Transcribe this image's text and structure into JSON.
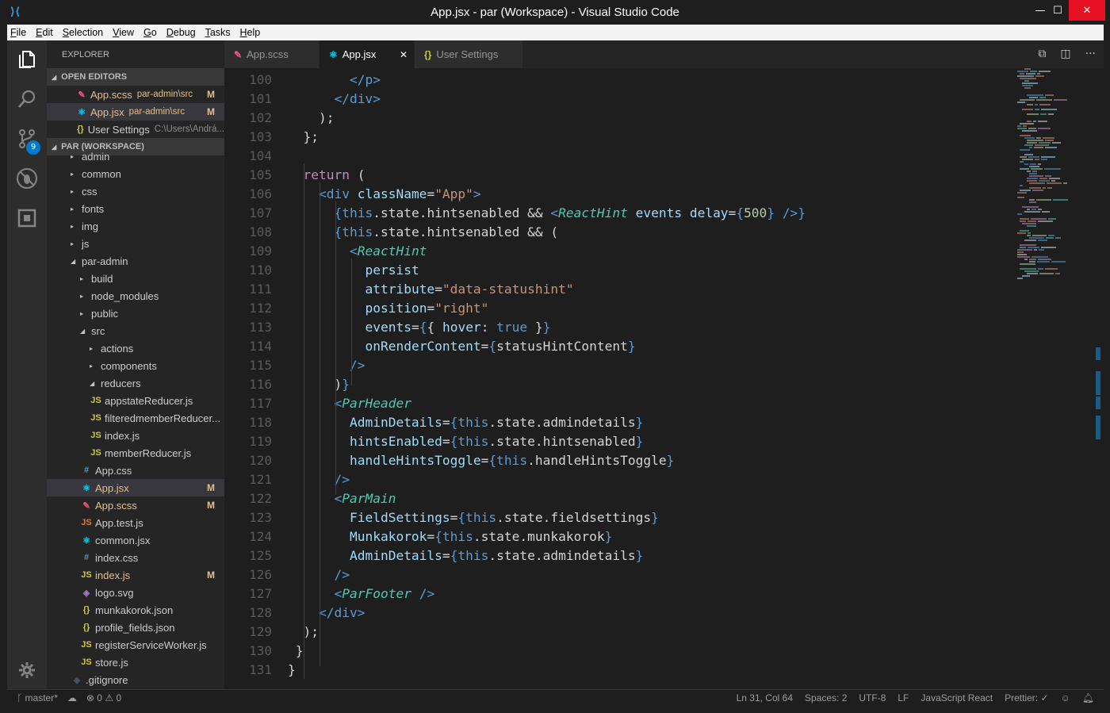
{
  "window": {
    "title": "App.jsx - par (Workspace) - Visual Studio Code",
    "min": "—",
    "max": "☐",
    "close": "✕"
  },
  "menu": [
    {
      "label": "File",
      "u": "F",
      "rest": "ile"
    },
    {
      "label": "Edit",
      "u": "E",
      "rest": "dit"
    },
    {
      "label": "Selection",
      "u": "S",
      "rest": "election"
    },
    {
      "label": "View",
      "u": "V",
      "rest": "iew"
    },
    {
      "label": "Go",
      "u": "G",
      "rest": "o"
    },
    {
      "label": "Debug",
      "u": "D",
      "rest": "ebug"
    },
    {
      "label": "Tasks",
      "u": "T",
      "rest": "asks"
    },
    {
      "label": "Help",
      "u": "H",
      "rest": "elp"
    }
  ],
  "activity": {
    "scm_badge": "9"
  },
  "sidebar": {
    "title": "EXPLORER",
    "open_editors_label": "OPEN EDITORS",
    "workspace_label": "PAR (WORKSPACE)",
    "open_editors": [
      {
        "name": "App.scss",
        "desc": "par-admin\\src",
        "mod": "M",
        "icon": "✎",
        "color": "#e2c08d",
        "iconColor": "#f55385"
      },
      {
        "name": "App.jsx",
        "desc": "par-admin\\src",
        "mod": "M",
        "icon": "⚛",
        "color": "#e2c08d",
        "iconColor": "#00d8ff"
      },
      {
        "name": "User Settings",
        "desc": "C:\\Users\\Andrá...",
        "mod": "",
        "icon": "{}",
        "color": "#cccccc",
        "iconColor": "#cbcb41"
      }
    ],
    "tree": [
      {
        "name": "admin",
        "indent": 0,
        "arrow": "▸",
        "icon": "",
        "mod": ""
      },
      {
        "name": "common",
        "indent": 0,
        "arrow": "▸",
        "icon": "",
        "mod": ""
      },
      {
        "name": "css",
        "indent": 0,
        "arrow": "▸",
        "icon": "",
        "mod": ""
      },
      {
        "name": "fonts",
        "indent": 0,
        "arrow": "▸",
        "icon": "",
        "mod": ""
      },
      {
        "name": "img",
        "indent": 0,
        "arrow": "▸",
        "icon": "",
        "mod": ""
      },
      {
        "name": "js",
        "indent": 0,
        "arrow": "▸",
        "icon": "",
        "mod": ""
      },
      {
        "name": "par-admin",
        "indent": 0,
        "arrow": "◢",
        "icon": "",
        "mod": ""
      },
      {
        "name": "build",
        "indent": 1,
        "arrow": "▸",
        "icon": "",
        "mod": ""
      },
      {
        "name": "node_modules",
        "indent": 1,
        "arrow": "▸",
        "icon": "",
        "mod": ""
      },
      {
        "name": "public",
        "indent": 1,
        "arrow": "▸",
        "icon": "",
        "mod": ""
      },
      {
        "name": "src",
        "indent": 1,
        "arrow": "◢",
        "icon": "",
        "mod": ""
      },
      {
        "name": "actions",
        "indent": 2,
        "arrow": "▸",
        "icon": "",
        "mod": ""
      },
      {
        "name": "components",
        "indent": 2,
        "arrow": "▸",
        "icon": "",
        "mod": ""
      },
      {
        "name": "reducers",
        "indent": 2,
        "arrow": "◢",
        "icon": "",
        "mod": ""
      },
      {
        "name": "appstateReducer.js",
        "indent": 3,
        "arrow": "",
        "icon": "JS",
        "iconColor": "#cbcb41",
        "mod": ""
      },
      {
        "name": "filteredmemberReducer...",
        "indent": 3,
        "arrow": "",
        "icon": "JS",
        "iconColor": "#cbcb41",
        "mod": ""
      },
      {
        "name": "index.js",
        "indent": 3,
        "arrow": "",
        "icon": "JS",
        "iconColor": "#cbcb41",
        "mod": ""
      },
      {
        "name": "memberReducer.js",
        "indent": 3,
        "arrow": "",
        "icon": "JS",
        "iconColor": "#cbcb41",
        "mod": ""
      },
      {
        "name": "App.css",
        "indent": 2,
        "arrow": "",
        "icon": "#",
        "iconColor": "#519aba",
        "mod": ""
      },
      {
        "name": "App.jsx",
        "indent": 2,
        "arrow": "",
        "icon": "⚛",
        "iconColor": "#00d8ff",
        "mod": "M",
        "selected": true
      },
      {
        "name": "App.scss",
        "indent": 2,
        "arrow": "",
        "icon": "✎",
        "iconColor": "#f55385",
        "mod": "M"
      },
      {
        "name": "App.test.js",
        "indent": 2,
        "arrow": "",
        "icon": "JS",
        "iconColor": "#e37933",
        "mod": ""
      },
      {
        "name": "common.jsx",
        "indent": 2,
        "arrow": "",
        "icon": "⚛",
        "iconColor": "#00d8ff",
        "mod": ""
      },
      {
        "name": "index.css",
        "indent": 2,
        "arrow": "",
        "icon": "#",
        "iconColor": "#519aba",
        "mod": ""
      },
      {
        "name": "index.js",
        "indent": 2,
        "arrow": "",
        "icon": "JS",
        "iconColor": "#cbcb41",
        "mod": "M"
      },
      {
        "name": "logo.svg",
        "indent": 2,
        "arrow": "",
        "icon": "◈",
        "iconColor": "#a074c4",
        "mod": ""
      },
      {
        "name": "munkakorok.json",
        "indent": 2,
        "arrow": "",
        "icon": "{}",
        "iconColor": "#cbcb41",
        "mod": ""
      },
      {
        "name": "profile_fields.json",
        "indent": 2,
        "arrow": "",
        "icon": "{}",
        "iconColor": "#cbcb41",
        "mod": ""
      },
      {
        "name": "registerServiceWorker.js",
        "indent": 2,
        "arrow": "",
        "icon": "JS",
        "iconColor": "#cbcb41",
        "mod": ""
      },
      {
        "name": "store.js",
        "indent": 2,
        "arrow": "",
        "icon": "JS",
        "iconColor": "#cbcb41",
        "mod": ""
      },
      {
        "name": ".gitignore",
        "indent": 1,
        "arrow": "",
        "icon": "◆",
        "iconColor": "#41535b",
        "mod": ""
      }
    ]
  },
  "tabs": [
    {
      "label": "App.scss",
      "icon": "✎",
      "iconColor": "#f55385",
      "active": false
    },
    {
      "label": "App.jsx",
      "icon": "⚛",
      "iconColor": "#00d8ff",
      "active": true,
      "close": "✕"
    },
    {
      "label": "User Settings",
      "icon": "{}",
      "iconColor": "#cbcb41",
      "active": false
    }
  ],
  "editor": {
    "lines": [
      {
        "n": "100",
        "html": "        <span class='tg'>&lt;/p&gt;</span>"
      },
      {
        "n": "101",
        "html": "      <span class='tg'>&lt;/div&gt;</span>"
      },
      {
        "n": "102",
        "html": "    );"
      },
      {
        "n": "103",
        "html": "  };"
      },
      {
        "n": "104",
        "html": ""
      },
      {
        "n": "105",
        "html": "  <span class='kw'>return</span> ("
      },
      {
        "n": "106",
        "html": "    <span class='tg'>&lt;div</span> <span class='at'>className</span>=<span class='st'>\"App\"</span><span class='tg'>&gt;</span>"
      },
      {
        "n": "107",
        "html": "      <span class='tg'>{</span><span class='th'>this</span>.state.hintsenabled &amp;&amp; <span class='tg'>&lt;</span><span class='cm'>ReactHint</span> <span class='at'>events</span> <span class='at'>delay</span>=<span class='tg'>{</span><span class='nm'>500</span><span class='tg'>}</span> <span class='tg'>/&gt;</span><span class='tg'>}</span>"
      },
      {
        "n": "108",
        "html": "      <span class='tg'>{</span><span class='th'>this</span>.state.hintsenabled &amp;&amp; ("
      },
      {
        "n": "109",
        "html": "        <span class='tg'>&lt;</span><span class='cm'>ReactHint</span>"
      },
      {
        "n": "110",
        "html": "          <span class='at'>persist</span>"
      },
      {
        "n": "111",
        "html": "          <span class='at'>attribute</span>=<span class='st'>\"data-statushint\"</span>"
      },
      {
        "n": "112",
        "html": "          <span class='at'>position</span>=<span class='st'>\"right\"</span>"
      },
      {
        "n": "113",
        "html": "          <span class='at'>events</span>=<span class='tg'>{</span>{ <span class='at'>hover</span>: <span class='th'>true</span> }<span class='tg'>}</span>"
      },
      {
        "n": "114",
        "html": "          <span class='at'>onRenderContent</span>=<span class='tg'>{</span>statusHintContent<span class='tg'>}</span>"
      },
      {
        "n": "115",
        "html": "        <span class='tg'>/&gt;</span>"
      },
      {
        "n": "116",
        "html": "      )<span class='tg'>}</span>"
      },
      {
        "n": "117",
        "html": "      <span class='tg'>&lt;</span><span class='cm'>ParHeader</span>"
      },
      {
        "n": "118",
        "html": "        <span class='at'>AdminDetails</span>=<span class='tg'>{</span><span class='th'>this</span>.state.admindetails<span class='tg'>}</span>"
      },
      {
        "n": "119",
        "html": "        <span class='at'>hintsEnabled</span>=<span class='tg'>{</span><span class='th'>this</span>.state.hintsenabled<span class='tg'>}</span>"
      },
      {
        "n": "120",
        "html": "        <span class='at'>handleHintsToggle</span>=<span class='tg'>{</span><span class='th'>this</span>.handleHintsToggle<span class='tg'>}</span>"
      },
      {
        "n": "121",
        "html": "      <span class='tg'>/&gt;</span>"
      },
      {
        "n": "122",
        "html": "      <span class='tg'>&lt;</span><span class='cm'>ParMain</span>"
      },
      {
        "n": "123",
        "html": "        <span class='at'>FieldSettings</span>=<span class='tg'>{</span><span class='th'>this</span>.state.fieldsettings<span class='tg'>}</span>"
      },
      {
        "n": "124",
        "html": "        <span class='at'>Munkakorok</span>=<span class='tg'>{</span><span class='th'>this</span>.state.munkakorok<span class='tg'>}</span>"
      },
      {
        "n": "125",
        "html": "        <span class='at'>AdminDetails</span>=<span class='tg'>{</span><span class='th'>this</span>.state.admindetails<span class='tg'>}</span>"
      },
      {
        "n": "126",
        "html": "      <span class='tg'>/&gt;</span>"
      },
      {
        "n": "127",
        "html": "      <span class='tg'>&lt;</span><span class='cm'>ParFooter</span> <span class='tg'>/&gt;</span>"
      },
      {
        "n": "128",
        "html": "    <span class='tg'>&lt;/div&gt;</span>"
      },
      {
        "n": "129",
        "html": "  );"
      },
      {
        "n": "130",
        "html": " }"
      },
      {
        "n": "131",
        "html": "}"
      }
    ]
  },
  "status": {
    "branch": "master*",
    "errors": "0",
    "warnings": "0",
    "position": "Ln 31, Col 64",
    "spaces": "Spaces: 2",
    "encoding": "UTF-8",
    "eol": "LF",
    "language": "JavaScript React",
    "formatter": "Prettier: ✓"
  }
}
